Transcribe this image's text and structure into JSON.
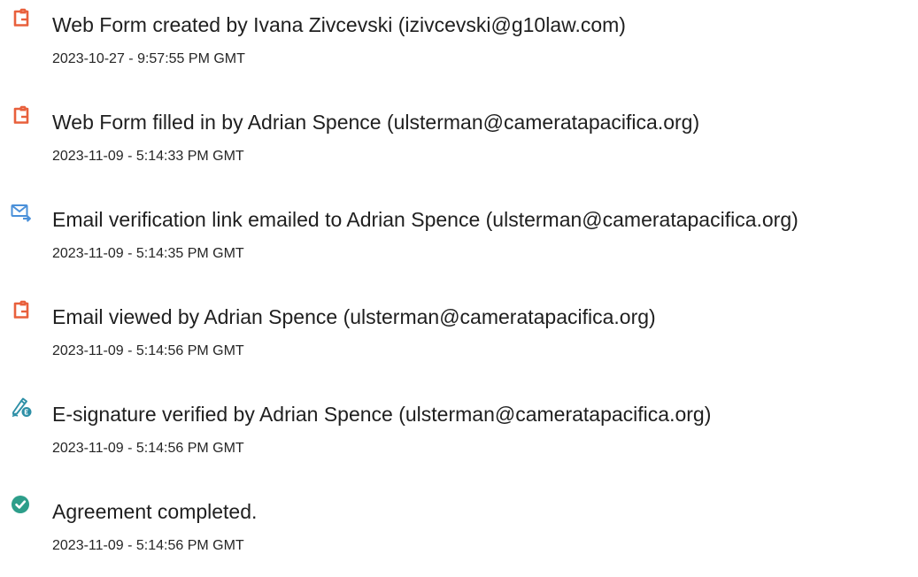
{
  "events": [
    {
      "icon": "document-icon",
      "text": "Web Form created by Ivana Zivcevski (izivcevski@g10law.com)",
      "time": "2023-10-27 - 9:57:55 PM GMT"
    },
    {
      "icon": "document-icon",
      "text": "Web Form filled in by Adrian Spence (ulsterman@cameratapacifica.org)",
      "time": "2023-11-09 - 5:14:33 PM GMT"
    },
    {
      "icon": "email-send-icon",
      "text": "Email verification link emailed to Adrian Spence (ulsterman@cameratapacifica.org)",
      "time": "2023-11-09 - 5:14:35 PM GMT"
    },
    {
      "icon": "document-icon",
      "text": "Email viewed by Adrian Spence (ulsterman@cameratapacifica.org)",
      "time": "2023-11-09 - 5:14:56 PM GMT"
    },
    {
      "icon": "e-signature-icon",
      "text": "E-signature verified by Adrian Spence (ulsterman@cameratapacifica.org)",
      "time": "2023-11-09 - 5:14:56 PM GMT"
    },
    {
      "icon": "checkmark-circle-icon",
      "text": "Agreement completed.",
      "time": "2023-11-09 - 5:14:56 PM GMT"
    }
  ],
  "colors": {
    "document_icon": "#e8603c",
    "email_icon": "#4a90d9",
    "signature_icon": "#2d8fa6",
    "check_icon": "#2d9e8a",
    "text": "#1f1f1f"
  }
}
